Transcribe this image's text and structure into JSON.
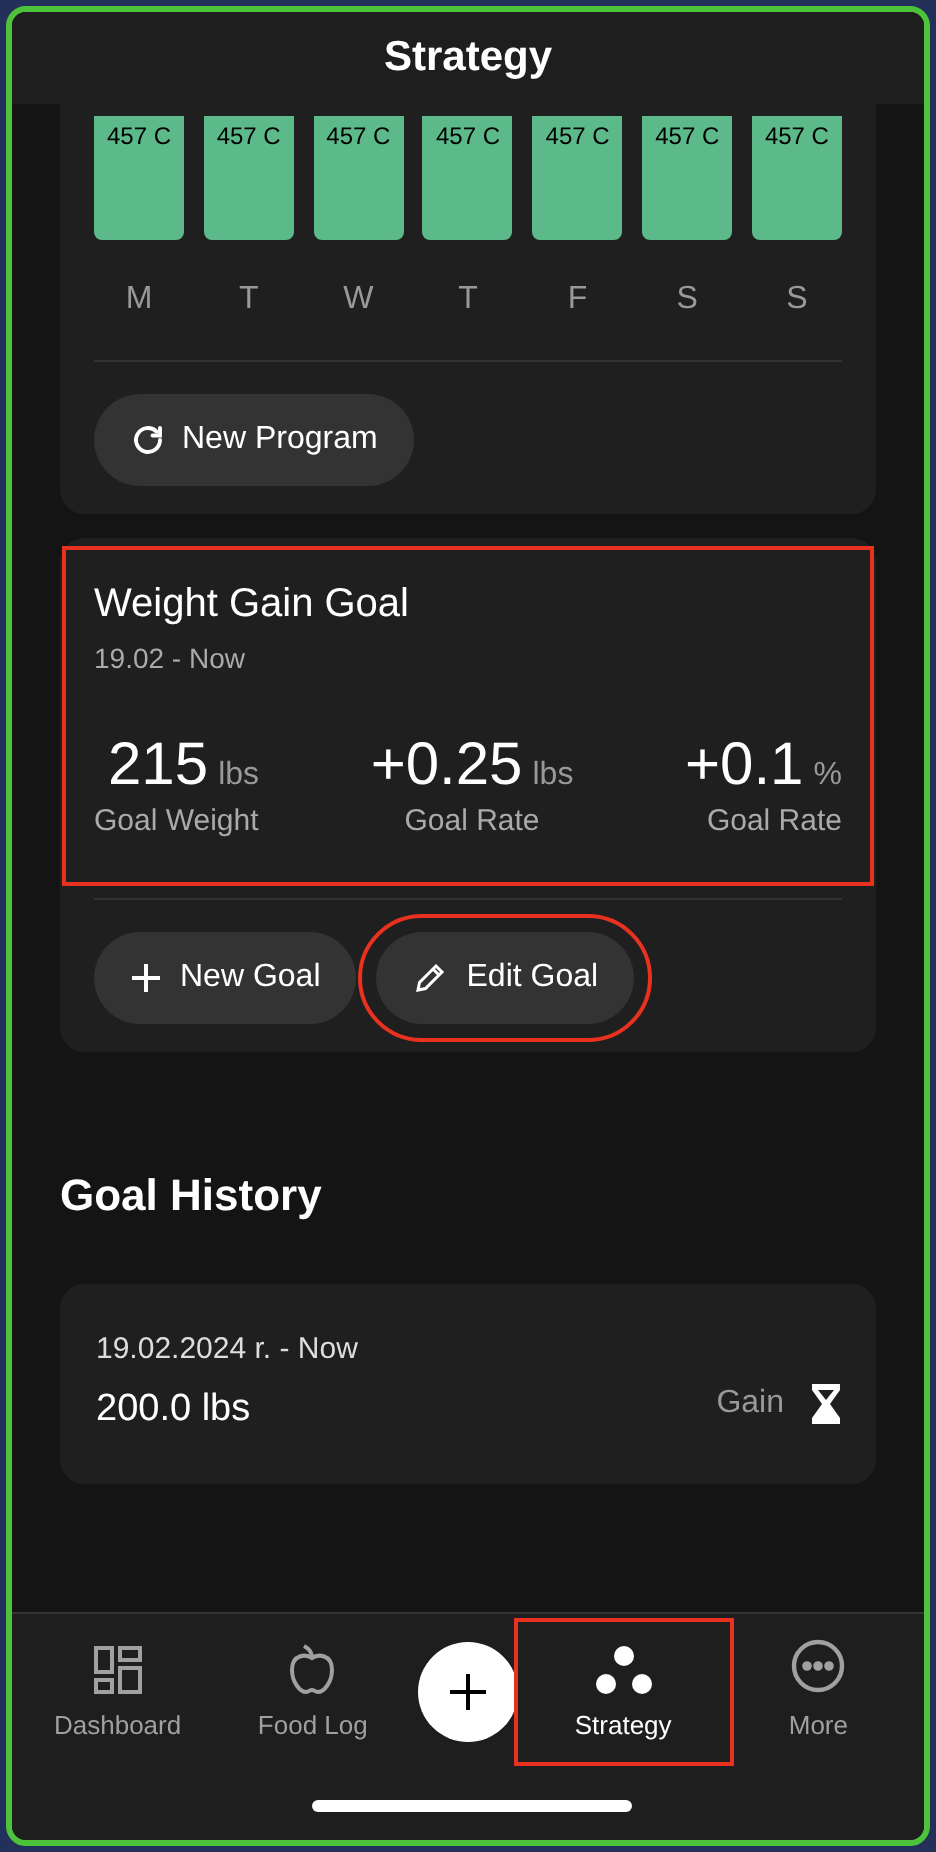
{
  "header": {
    "title": "Strategy"
  },
  "program": {
    "days": [
      {
        "value": "457 C",
        "day": "M"
      },
      {
        "value": "457 C",
        "day": "T"
      },
      {
        "value": "457 C",
        "day": "W"
      },
      {
        "value": "457 C",
        "day": "T"
      },
      {
        "value": "457 C",
        "day": "F"
      },
      {
        "value": "457 C",
        "day": "S"
      },
      {
        "value": "457 C",
        "day": "S"
      }
    ],
    "button": "New Program"
  },
  "goal": {
    "title": "Weight Gain Goal",
    "period": "19.02 - Now",
    "highlighted": true,
    "stats": [
      {
        "value": "215",
        "unit": "lbs",
        "label": "Goal Weight"
      },
      {
        "value": "+0.25",
        "unit": "lbs",
        "label": "Goal Rate"
      },
      {
        "value": "+0.1",
        "unit": "%",
        "label": "Goal Rate"
      }
    ],
    "buttons": [
      {
        "kind": "plus",
        "label": "New Goal",
        "highlighted": false
      },
      {
        "kind": "pencil",
        "label": "Edit Goal",
        "highlighted": true
      }
    ]
  },
  "history": {
    "title": "Goal History",
    "entries": [
      {
        "period": "19.02.2024 r. - Now",
        "weight": "200.0 lbs",
        "type": "Gain"
      }
    ]
  },
  "nav": [
    {
      "kind": "dashboard",
      "label": "Dashboard",
      "selected": false,
      "highlighted": false
    },
    {
      "kind": "food",
      "label": "Food Log",
      "selected": false,
      "highlighted": false
    },
    {
      "kind": "add"
    },
    {
      "kind": "strategy",
      "label": "Strategy",
      "selected": true,
      "highlighted": true
    },
    {
      "kind": "more",
      "label": "More",
      "selected": false,
      "highlighted": false
    }
  ]
}
